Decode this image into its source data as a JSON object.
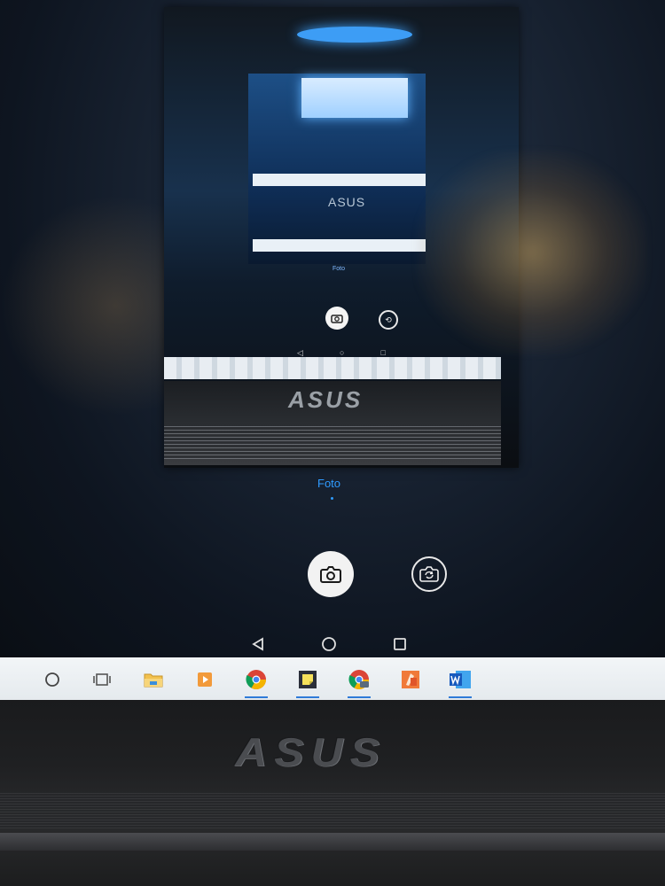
{
  "camera": {
    "mode_label": "Foto",
    "shutter_icon": "camera-icon",
    "switch_icon": "switch-camera-icon"
  },
  "phone_nav": {
    "back_icon": "back-triangle-icon",
    "home_icon": "home-circle-icon",
    "recents_icon": "recents-square-icon"
  },
  "mirror": {
    "brand": "ASUS",
    "mode_label": "Foto"
  },
  "taskbar": {
    "items": [
      {
        "icon": "search-circle-icon"
      },
      {
        "icon": "task-view-icon"
      },
      {
        "icon": "file-explorer-icon"
      },
      {
        "icon": "media-player-icon"
      },
      {
        "icon": "chrome-icon"
      },
      {
        "icon": "sticky-notes-icon"
      },
      {
        "icon": "chrome-alt-icon"
      },
      {
        "icon": "paint-icon"
      },
      {
        "icon": "word-icon"
      }
    ]
  },
  "bezel": {
    "brand": "ASUS"
  },
  "colors": {
    "accent_blue": "#2f9bff",
    "taskbar_bg": "#f2f5f7",
    "bezel": "#1f2022"
  }
}
